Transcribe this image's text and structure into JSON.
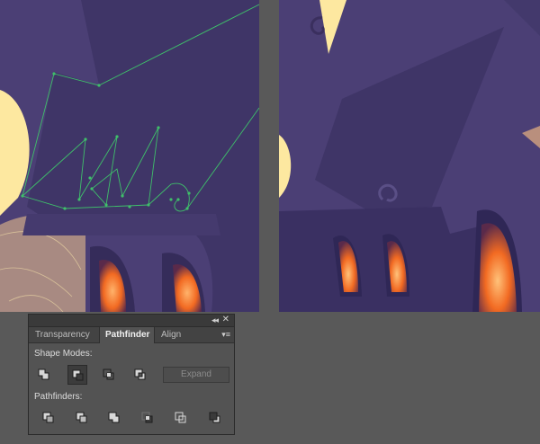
{
  "panel": {
    "tabs": [
      {
        "label": "Transparency"
      },
      {
        "label": "Pathfinder"
      },
      {
        "label": "Align"
      }
    ],
    "collapse_glyph": "◂◂",
    "close_glyph": "✕",
    "menu_glyph": "▾≡",
    "shape_modes_label": "Shape Modes:",
    "expand_label": "Expand",
    "pathfinders_label": "Pathfinders:",
    "shape_modes": [
      {
        "icon": "unite-icon"
      },
      {
        "icon": "minus-front-icon"
      },
      {
        "icon": "intersect-icon"
      },
      {
        "icon": "exclude-icon"
      }
    ],
    "pathfinders": [
      {
        "icon": "divide-icon"
      },
      {
        "icon": "trim-icon"
      },
      {
        "icon": "merge-icon"
      },
      {
        "icon": "crop-icon"
      },
      {
        "icon": "outline-icon"
      },
      {
        "icon": "minus-back-icon"
      }
    ]
  },
  "colors": {
    "background": "#595959",
    "artboard": "#4b3f75",
    "roof": "#3f3567",
    "moon": "#fde8a0",
    "ground": "#a88a82",
    "window_glow": "#f26a22",
    "path_stroke": "#3fc06a"
  }
}
